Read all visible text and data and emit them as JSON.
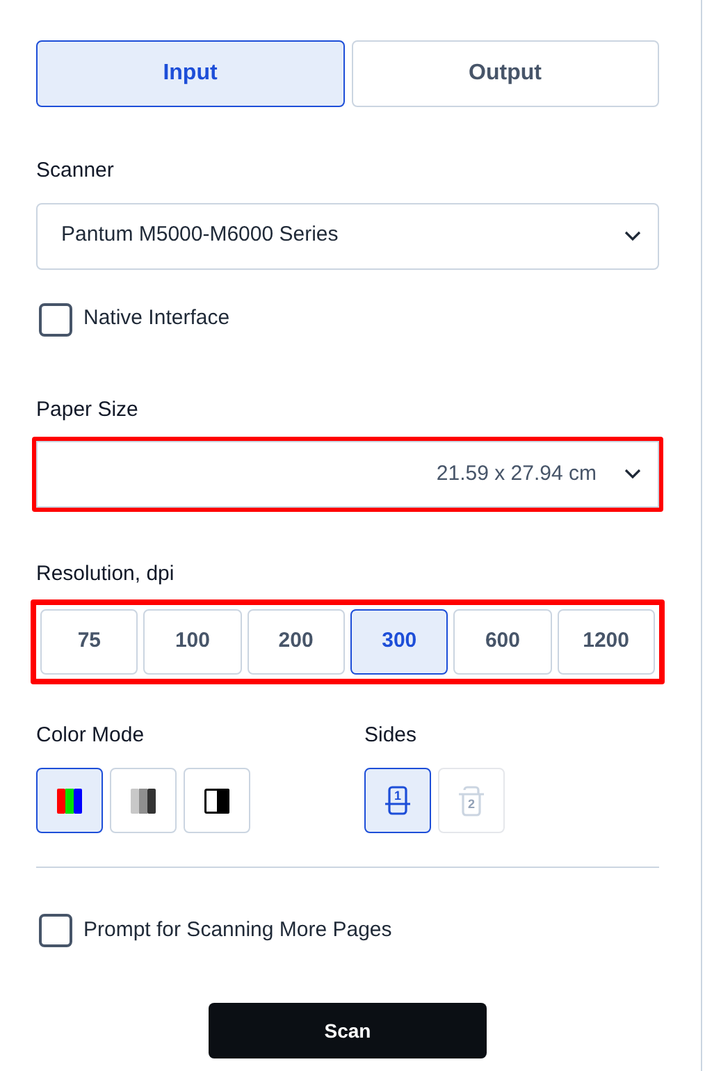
{
  "tabs": [
    {
      "label": "Input",
      "selected": true
    },
    {
      "label": "Output",
      "selected": false
    }
  ],
  "scanner": {
    "label": "Scanner",
    "value": "Pantum M5000-M6000 Series"
  },
  "native_interface": {
    "label": "Native Interface",
    "checked": false
  },
  "paper_size": {
    "label": "Paper Size",
    "value": "21.59 x 27.94 cm",
    "highlighted": true
  },
  "resolution": {
    "label": "Resolution, dpi",
    "highlighted": true,
    "options": [
      {
        "label": "75",
        "selected": false
      },
      {
        "label": "100",
        "selected": false
      },
      {
        "label": "200",
        "selected": false
      },
      {
        "label": "300",
        "selected": true
      },
      {
        "label": "600",
        "selected": false
      },
      {
        "label": "1200",
        "selected": false
      }
    ]
  },
  "color_mode": {
    "label": "Color Mode",
    "options": [
      {
        "kind": "color",
        "selected": true
      },
      {
        "kind": "grayscale",
        "selected": false
      },
      {
        "kind": "blackwhite",
        "selected": false
      }
    ]
  },
  "sides": {
    "label": "Sides",
    "options": [
      {
        "kind": "single",
        "label": "1",
        "selected": true,
        "disabled": false
      },
      {
        "kind": "double",
        "label": "2",
        "selected": false,
        "disabled": true
      }
    ]
  },
  "prompt_more_pages": {
    "label": "Prompt for Scanning More Pages",
    "checked": false
  },
  "scan_button": {
    "label": "Scan"
  }
}
